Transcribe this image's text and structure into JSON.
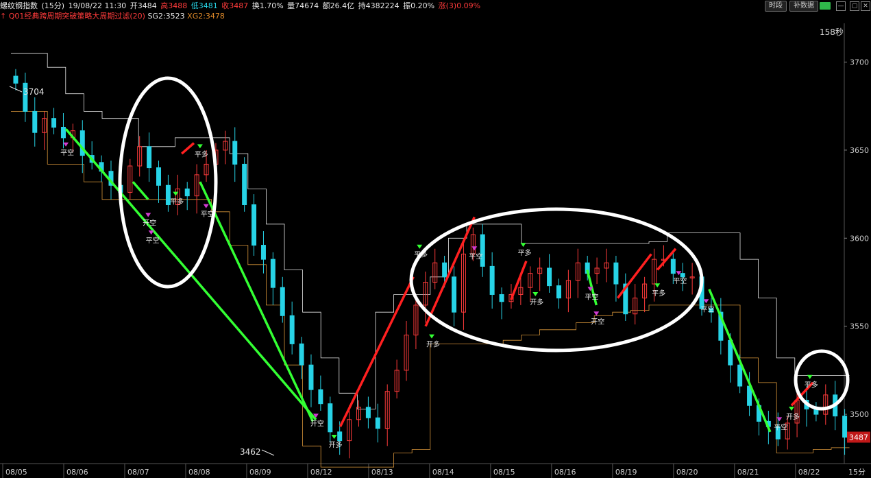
{
  "header": {
    "name": "螺纹钢指数",
    "period": "(15分)",
    "datetime": "19/08/22 11:30",
    "open": "开3484",
    "high": "高3488",
    "low": "低3481",
    "close": "收3487",
    "turnover": "换1.70%",
    "volume": "量74674",
    "amount": "额26.4亿",
    "position": "持4382224",
    "amplitude": "振0.20%",
    "change": "涨(3)0.09%"
  },
  "indicator": {
    "name": "Q01经典跨周期突破策略大周期过滤(20)",
    "sg2": "SG2:3523",
    "xg2": "XG2:3478"
  },
  "buttons": {
    "time_share": "时段",
    "fill_data": "补数据"
  },
  "countdown": "158秒",
  "colors": {
    "up": "#ff3b3b",
    "down": "#27d3e6",
    "upper_channel": "#e8e8e8",
    "lower_channel": "#d9963a",
    "long_trend": "#ff2020",
    "short_trend": "#33ff33",
    "circle": "#ffffff"
  },
  "chart_data": {
    "type": "candlestick",
    "ylim": [
      3472,
      3722
    ],
    "y_ticks": [
      "3700",
      "3650",
      "3600",
      "3550",
      "3500"
    ],
    "x_labels": [
      "08/05",
      "08/06",
      "08/07",
      "08/08",
      "08/09",
      "08/12",
      "08/13",
      "08/14",
      "08/15",
      "08/16",
      "08/19",
      "08/20",
      "08/21",
      "08/22"
    ],
    "period_label": "15分",
    "max_label": "3704",
    "min_label": "3462",
    "last_price_label": "3487",
    "channel_upper": [
      3705,
      3705,
      3697,
      3682,
      3672,
      3668,
      3668,
      3652,
      3652,
      3657,
      3657,
      3657,
      3648,
      3628,
      3608,
      3582,
      3558,
      3532,
      3512,
      3503,
      3558,
      3568,
      3568,
      3578,
      3600,
      3608,
      3608,
      3608,
      3597,
      3597,
      3597,
      3597,
      3597,
      3597,
      3597,
      3598,
      3603,
      3603,
      3603,
      3603,
      3588,
      3566,
      3532,
      3522,
      3522,
      3522
    ],
    "channel_lower": [
      3672,
      3672,
      3642,
      3642,
      3632,
      3622,
      3622,
      3622,
      3622,
      3622,
      3622,
      3615,
      3596,
      3585,
      3562,
      3528,
      3482,
      3470,
      3470,
      3470,
      3470,
      3478,
      3480,
      3540,
      3540,
      3540,
      3540,
      3542,
      3545,
      3548,
      3548,
      3552,
      3556,
      3558,
      3559,
      3562,
      3562,
      3562,
      3562,
      3562,
      3532,
      3518,
      3478,
      3478,
      3480,
      3481
    ],
    "candles_close": [
      3688,
      3672,
      3660,
      3668,
      3663,
      3657,
      3661,
      3647,
      3643,
      3638,
      3630,
      3626,
      3641,
      3652,
      3640,
      3630,
      3619,
      3628,
      3624,
      3636,
      3642,
      3650,
      3655,
      3642,
      3619,
      3596,
      3588,
      3572,
      3556,
      3540,
      3528,
      3514,
      3506,
      3490,
      3485,
      3497,
      3504,
      3498,
      3492,
      3513,
      3525,
      3545,
      3562,
      3575,
      3586,
      3578,
      3558,
      3591,
      3602,
      3584,
      3568,
      3564,
      3568,
      3572,
      3580,
      3583,
      3573,
      3566,
      3576,
      3586,
      3580,
      3583,
      3586,
      3574,
      3557,
      3566,
      3574,
      3588,
      3588,
      3580,
      3578,
      3578,
      3560,
      3558,
      3542,
      3528,
      3516,
      3505,
      3496,
      3493,
      3486,
      3495,
      3508,
      3503,
      3500,
      3511,
      3499,
      3487
    ],
    "signals": [
      {
        "label": "平空",
        "value": 3652
      },
      {
        "label": "开空",
        "value": 3612
      },
      {
        "label": "平空",
        "value": 3602
      },
      {
        "label": "平多",
        "value": 3624
      },
      {
        "label": "平多",
        "value": 3651
      },
      {
        "label": "平空",
        "value": 3617
      },
      {
        "label": "开空",
        "value": 3498
      },
      {
        "label": "开多",
        "value": 3486
      },
      {
        "label": "平多",
        "value": 3594
      },
      {
        "label": "开多",
        "value": 3543
      },
      {
        "label": "平空",
        "value": 3593
      },
      {
        "label": "平多",
        "value": 3595
      },
      {
        "label": "开多",
        "value": 3567
      },
      {
        "label": "平空",
        "value": 3570
      },
      {
        "label": "开空",
        "value": 3556
      },
      {
        "label": "平多",
        "value": 3572
      },
      {
        "label": "平空",
        "value": 3579
      },
      {
        "label": "平空",
        "value": 3563
      },
      {
        "label": "开多",
        "value": 3502
      },
      {
        "label": "平空",
        "value": 3496
      },
      {
        "label": "平多",
        "value": 3520
      }
    ],
    "trend_lines": [
      {
        "kind": "short",
        "from": [
          0.9,
          3662
        ],
        "to": [
          5.0,
          3497
        ]
      },
      {
        "kind": "short",
        "from": [
          2.0,
          3632
        ],
        "to": [
          2.25,
          3622
        ]
      },
      {
        "kind": "long",
        "from": [
          2.8,
          3648
        ],
        "to": [
          3.0,
          3654
        ]
      },
      {
        "kind": "short",
        "from": [
          3.1,
          3632
        ],
        "to": [
          4.95,
          3496
        ]
      },
      {
        "kind": "long",
        "from": [
          5.4,
          3493
        ],
        "to": [
          6.6,
          3578
        ]
      },
      {
        "kind": "long",
        "from": [
          6.8,
          3550
        ],
        "to": [
          7.6,
          3612
        ]
      },
      {
        "kind": "long",
        "from": [
          8.2,
          3565
        ],
        "to": [
          8.45,
          3587
        ]
      },
      {
        "kind": "short",
        "from": [
          9.45,
          3582
        ],
        "to": [
          9.6,
          3562
        ]
      },
      {
        "kind": "long",
        "from": [
          9.95,
          3566
        ],
        "to": [
          10.5,
          3591
        ]
      },
      {
        "kind": "long",
        "from": [
          10.6,
          3582
        ],
        "to": [
          10.9,
          3594
        ]
      },
      {
        "kind": "short",
        "from": [
          11.45,
          3571
        ],
        "to": [
          12.45,
          3490
        ]
      },
      {
        "kind": "long",
        "from": [
          12.8,
          3505
        ],
        "to": [
          13.15,
          3518
        ]
      }
    ],
    "circles": [
      "08/07-08/08",
      "08/14-08/19",
      "08/22"
    ]
  }
}
